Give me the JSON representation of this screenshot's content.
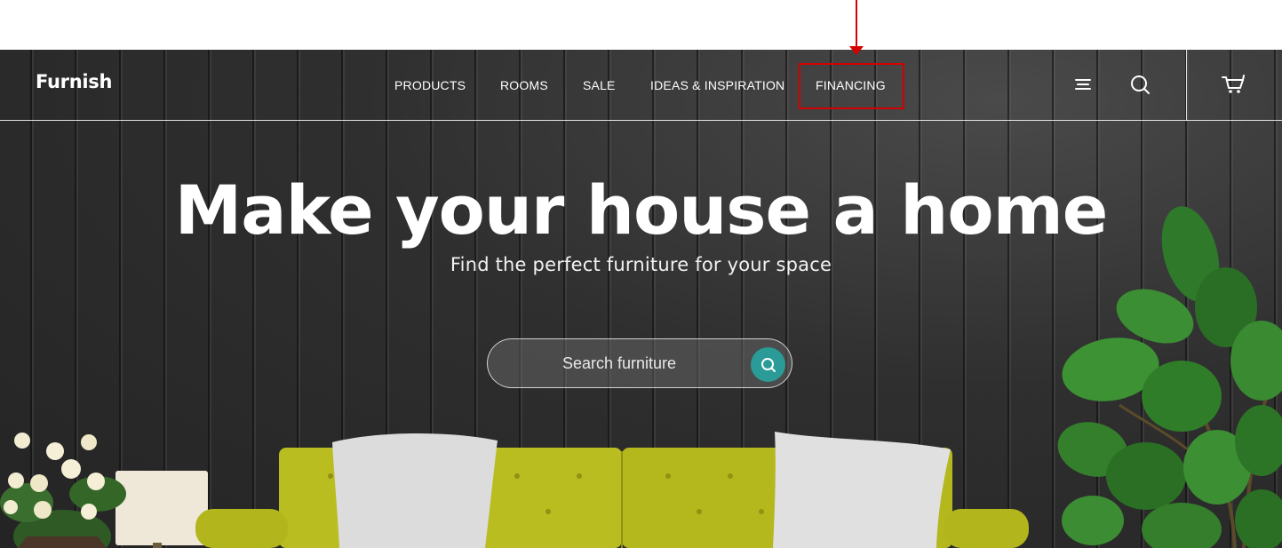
{
  "brand": {
    "logo": "Furnish"
  },
  "nav": {
    "items": [
      {
        "label": "PRODUCTS"
      },
      {
        "label": "ROOMS"
      },
      {
        "label": "SALE"
      },
      {
        "label": "IDEAS & INSPIRATION"
      },
      {
        "label": "FINANCING"
      }
    ],
    "icons": [
      "menu-icon",
      "search-icon",
      "cart-icon"
    ]
  },
  "hero": {
    "headline": "Make your house a home",
    "subtitle": "Find the perfect furniture for your space",
    "search": {
      "placeholder": "Search furniture"
    }
  },
  "colors": {
    "annotation": "#d40000",
    "accent": "#2a9b97",
    "sofa": "#b9bd1f",
    "wall": "#2c2c2c"
  }
}
